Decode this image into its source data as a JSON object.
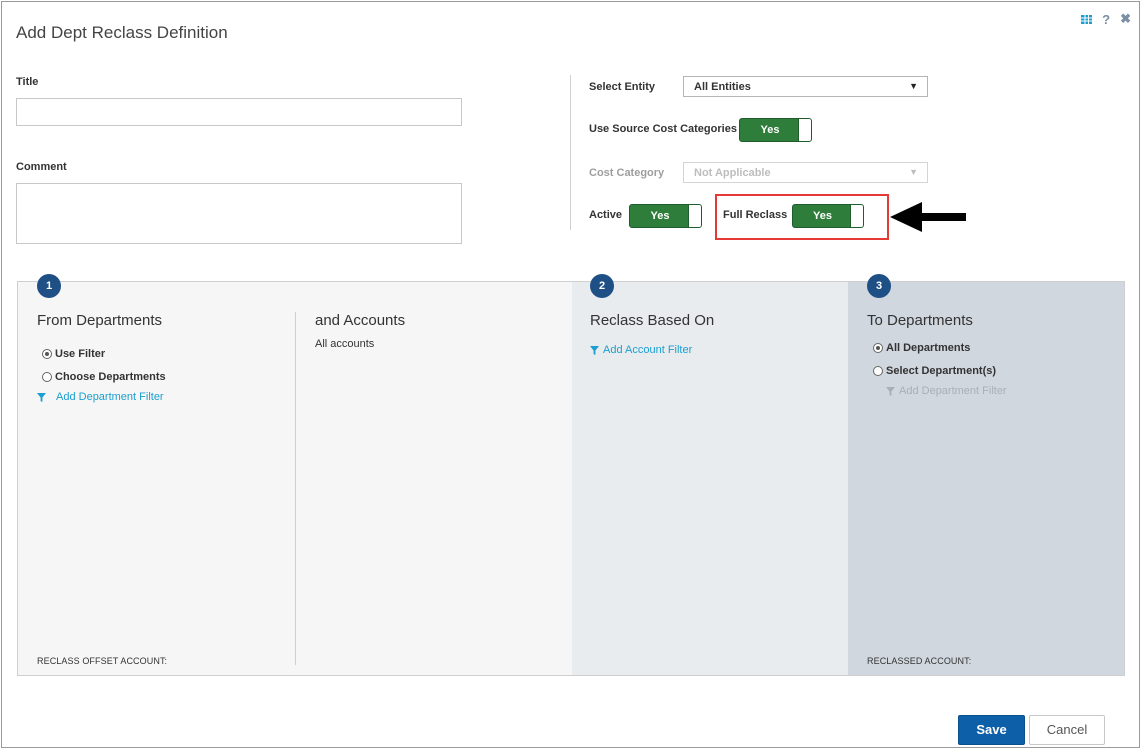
{
  "dialog": {
    "title": "Add Dept Reclass Definition",
    "help_label": "?",
    "close_label": "✖"
  },
  "form": {
    "title_label": "Title",
    "title_value": "",
    "comment_label": "Comment",
    "comment_value": "",
    "select_entity_label": "Select Entity",
    "select_entity_value": "All Entities",
    "use_source_cost_label": "Use Source Cost Categories",
    "use_source_cost_value": "Yes",
    "cost_category_label": "Cost Category",
    "cost_category_value": "Not Applicable",
    "active_label": "Active",
    "active_value": "Yes",
    "full_reclass_label": "Full Reclass",
    "full_reclass_value": "Yes"
  },
  "sections": {
    "from": {
      "step": "1",
      "title": "From Departments",
      "option_use_filter": "Use Filter",
      "option_choose": "Choose Departments",
      "add_filter": "Add Department Filter",
      "footer": "RECLASS OFFSET ACCOUNT:"
    },
    "accounts": {
      "title": "and Accounts",
      "value": "All accounts"
    },
    "based_on": {
      "step": "2",
      "title": "Reclass Based On",
      "add_filter": "Add Account Filter"
    },
    "to": {
      "step": "3",
      "title": "To Departments",
      "option_all": "All Departments",
      "option_select": "Select Department(s)",
      "add_filter": "Add Department Filter",
      "footer": "RECLASSED ACCOUNT:"
    }
  },
  "buttons": {
    "save": "Save",
    "cancel": "Cancel"
  },
  "colors": {
    "toggle_green": "#2e7d3a",
    "step_blue": "#1e4f85",
    "link_blue": "#1a9fd0",
    "save_blue": "#0d5fa8",
    "highlight_red": "#e53935"
  }
}
